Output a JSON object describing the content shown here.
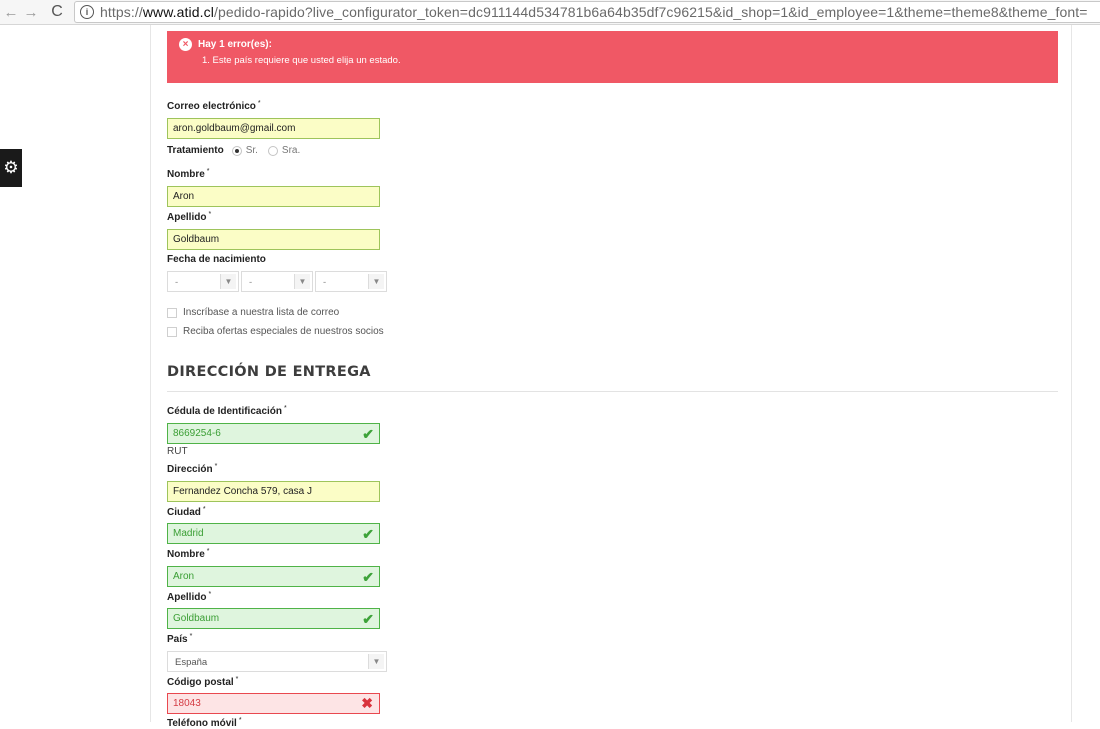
{
  "browser": {
    "back": "←",
    "forward": "→",
    "reload": "C",
    "info": "i",
    "url_prefix": "https://",
    "url_host": "www.atid.cl",
    "url_rest": "/pedido-rapido?live_configurator_token=dc911144d534781b6a64b35df7c96215&id_shop=1&id_employee=1&theme=theme8&theme_font="
  },
  "side_tab": {
    "icon": "⚙"
  },
  "alert": {
    "title": "Hay 1 error(es):",
    "items": [
      "1. Este país requiere que usted elija un estado."
    ]
  },
  "form": {
    "email_label": "Correo electrónico",
    "email_value": "aron.goldbaum@gmail.com",
    "title_label": "Tratamiento",
    "title_options": [
      "Sr.",
      "Sra."
    ],
    "firstname_label": "Nombre",
    "firstname_value": "Aron",
    "lastname_label": "Apellido",
    "lastname_value": "Goldbaum",
    "birthdate_label": "Fecha de nacimiento",
    "birthdate_values": [
      "-",
      "-",
      "-"
    ],
    "newsletter_label": "Inscríbase a nuestra lista de correo",
    "optin_label": "Reciba ofertas especiales de nuestros socios"
  },
  "delivery": {
    "title": "DIRECCIÓN DE ENTREGA",
    "dni_label": "Cédula de Identificación",
    "dni_value": "8669254-6",
    "dni_note": "RUT",
    "address_label": "Dirección",
    "address_value": "Fernandez Concha 579, casa J",
    "city_label": "Ciudad",
    "city_value": "Madrid",
    "firstname_label": "Nombre",
    "firstname_value": "Aron",
    "lastname_label": "Apellido",
    "lastname_value": "Goldbaum",
    "country_label": "País",
    "country_value": "España",
    "postcode_label": "Código postal",
    "postcode_value": "18043",
    "mobile_label": "Teléfono móvil"
  },
  "required_mark": "*",
  "icons": {
    "check": "✔",
    "cross": "✖",
    "arrow": "▼"
  },
  "colors": {
    "alert": "#f05865",
    "valid": "#4fb347",
    "invalid": "#e9484f",
    "filled": "#fbfdc6"
  }
}
